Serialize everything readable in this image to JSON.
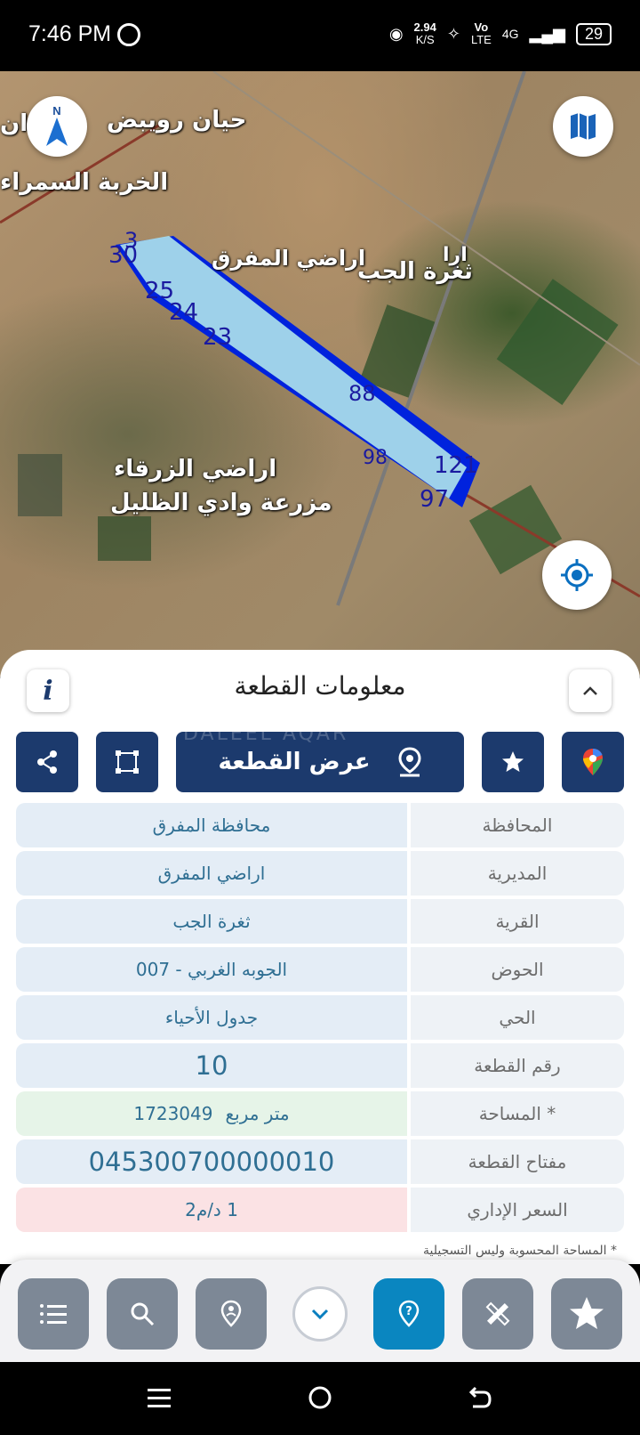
{
  "status_bar": {
    "time": "7:46 PM",
    "speed_value": "2.94",
    "speed_unit": "K/S",
    "network_vo": "Vo",
    "network_lte": "LTE",
    "network_4g": "4G",
    "battery": "29"
  },
  "map": {
    "labels": {
      "town_1": "حيان رويبض",
      "town_1_part": "ان",
      "town_2": "الخربة السمراء",
      "area_1": "اراضي المفرق",
      "area_1_part": "ارا",
      "village": "ثغرة الجب",
      "area_2": "اراضي الزرقاء",
      "farm": "مزرعة وادي الظليل"
    },
    "parcel_numbers": [
      "30",
      "25",
      "24",
      "23",
      "121",
      "97",
      "98",
      "88",
      "3"
    ],
    "icons": {
      "compass": "north-arrow-icon",
      "layers": "map-layers-icon",
      "locate": "gps-crosshair-icon"
    }
  },
  "sheet": {
    "title": "معلومات القطعة",
    "watermark": "DALEEL AQAR",
    "show_plot_label": "عرض القطعة",
    "rows": [
      {
        "label": "المحافظة",
        "value": "محافظة المفرق"
      },
      {
        "label": "المديرية",
        "value": "اراضي المفرق"
      },
      {
        "label": "القرية",
        "value": "ثغرة الجب"
      },
      {
        "label": "الحوض",
        "value": "الجوبه الغربي - 007"
      },
      {
        "label": "الحي",
        "value": "جدول الأحياء"
      },
      {
        "label": "رقم القطعة",
        "value": "10"
      },
      {
        "label": "المساحة *",
        "value": "1723049",
        "unit": "متر مربع"
      },
      {
        "label": "مفتاح القطعة",
        "value": "045300700000010"
      },
      {
        "label": "السعر الإداري",
        "value": "1 د/م2"
      }
    ],
    "footnote": "* المساحة المحسوبة وليس التسجيلية"
  },
  "colors": {
    "navy": "#1c3a6d",
    "accent_blue": "#0a86c0",
    "gray_button": "#7d8896",
    "value_text": "#2f6f93"
  }
}
